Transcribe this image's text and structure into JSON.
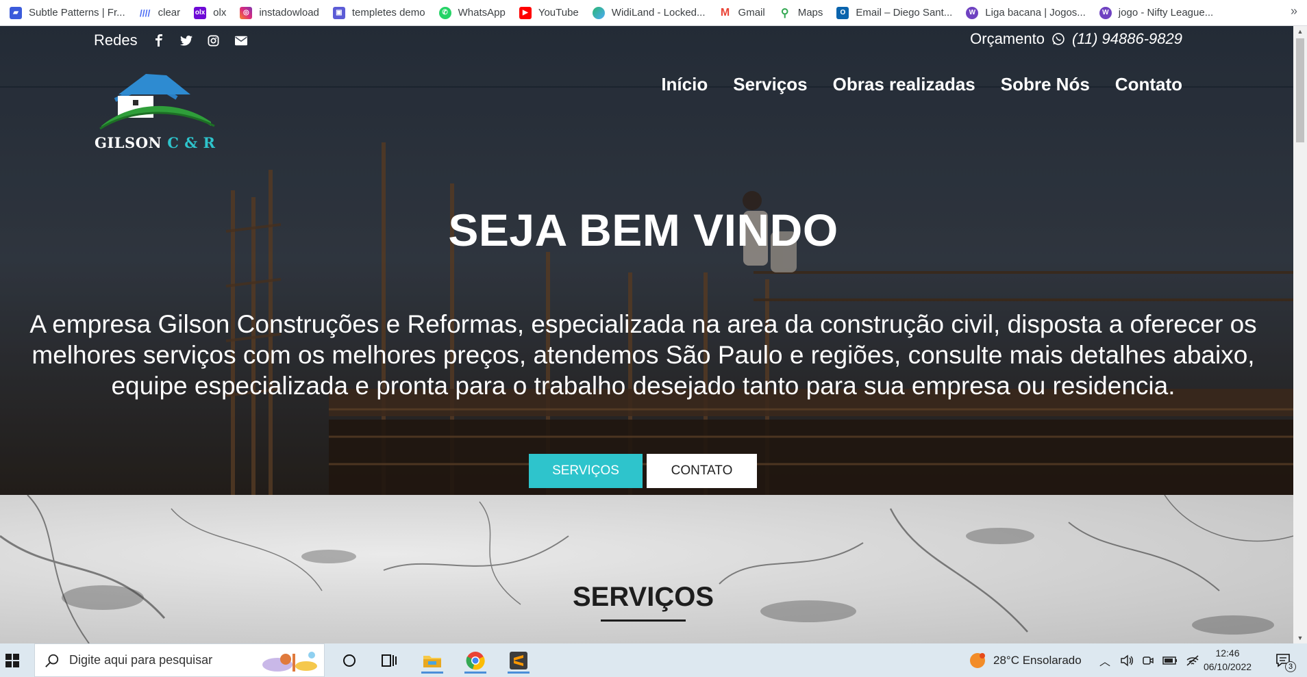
{
  "bookmarks": [
    {
      "label": "Subtle Patterns | Fr...",
      "icon": "subtle-patterns-icon",
      "color": "#3b5bdb"
    },
    {
      "label": "clear",
      "icon": "clear-icon",
      "color": "#4c6ef5"
    },
    {
      "label": "olx",
      "icon": "olx-icon",
      "color": "#6e0ad6"
    },
    {
      "label": "instadowload",
      "icon": "instagram-icon",
      "color": "#e1306c"
    },
    {
      "label": "templetes demo",
      "icon": "templates-icon",
      "color": "#5c5cd6"
    },
    {
      "label": "WhatsApp",
      "icon": "whatsapp-icon",
      "color": "#25d366"
    },
    {
      "label": "YouTube",
      "icon": "youtube-icon",
      "color": "#ff0000"
    },
    {
      "label": "WidiLand - Locked...",
      "icon": "widiland-icon",
      "color": "#2bb673"
    },
    {
      "label": "Gmail",
      "icon": "gmail-icon",
      "color": "#ea4335"
    },
    {
      "label": "Maps",
      "icon": "maps-icon",
      "color": "#34a853"
    },
    {
      "label": "Email – Diego Sant...",
      "icon": "outlook-icon",
      "color": "#0a64ad"
    },
    {
      "label": "Liga bacana | Jogos...",
      "icon": "liga-icon",
      "color": "#6f42c1"
    },
    {
      "label": "jogo - Nifty League...",
      "icon": "nifty-icon",
      "color": "#6f42c1"
    }
  ],
  "bookmarks_more": "»",
  "header": {
    "redes_label": "Redes",
    "social": [
      "facebook-icon",
      "twitter-icon",
      "instagram-icon",
      "envelope-icon"
    ],
    "orcamento_label": "Orçamento",
    "phone": "(11) 94886-9829"
  },
  "logo": {
    "name": "GILSON",
    "suffix": "C & R"
  },
  "nav": [
    "Início",
    "Serviços",
    "Obras realizadas",
    "Sobre Nós",
    "Contato"
  ],
  "hero": {
    "title": "SEJA BEM VINDO",
    "description": "A empresa Gilson Construções e Reformas, especializada na area da construção civil, disposta a oferecer os melhores serviços com os melhores preços, atendemos São Paulo e regiões, consulte mais detalhes abaixo, equipe especializada e pronta para o trabalho desejado tanto para sua empresa ou residencia.",
    "btn_services": "SERVIÇOS",
    "btn_contact": "CONTATO"
  },
  "services": {
    "title": "SERVIÇOS"
  },
  "taskbar": {
    "search_placeholder": "Digite aqui para pesquisar",
    "weather": "28°C  Ensolarado",
    "time": "12:46",
    "date": "06/10/2022",
    "notifications": "3"
  },
  "colors": {
    "accent": "#2ec4cc"
  }
}
